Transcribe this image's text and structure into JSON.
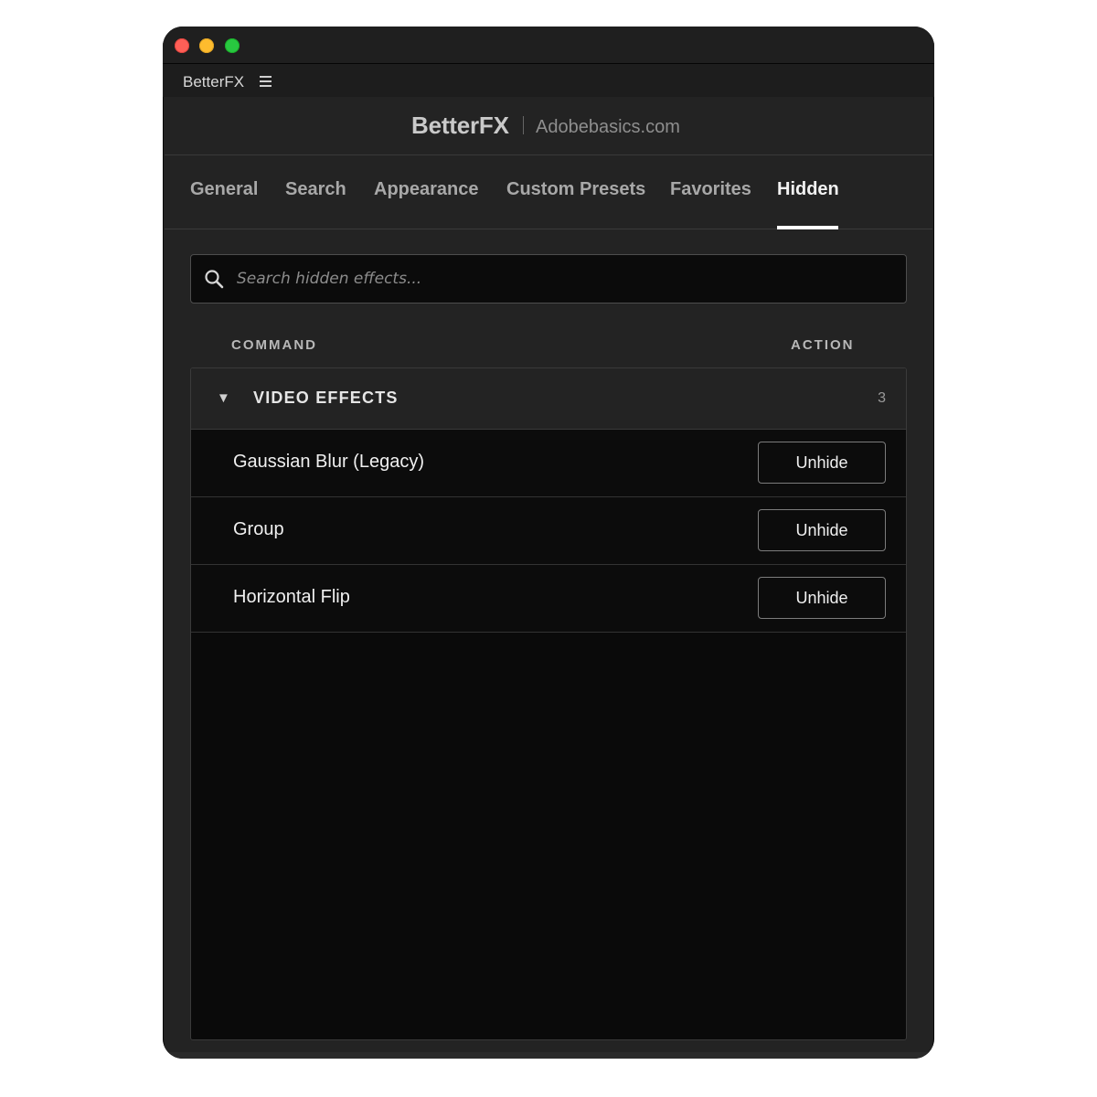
{
  "panel": {
    "name": "BetterFX"
  },
  "header": {
    "brand": "BetterFX",
    "site": "Adobebasics.com"
  },
  "tabs": [
    {
      "label": "General"
    },
    {
      "label": "Search"
    },
    {
      "label": "Appearance"
    },
    {
      "label": "Custom Presets"
    },
    {
      "label": "Favorites"
    },
    {
      "label": "Hidden",
      "active": true
    }
  ],
  "search": {
    "placeholder": "Search hidden effects..."
  },
  "columns": {
    "command": "COMMAND",
    "action": "ACTION"
  },
  "group": {
    "title": "VIDEO EFFECTS",
    "count": "3",
    "expanded": true
  },
  "rows": [
    {
      "label": "Gaussian Blur (Legacy)",
      "action": "Unhide"
    },
    {
      "label": "Group",
      "action": "Unhide"
    },
    {
      "label": "Horizontal Flip",
      "action": "Unhide"
    }
  ],
  "colors": {
    "window_bg": "#232323",
    "list_bg": "#0a0a0a",
    "active_tab": "#ffffff",
    "close": "#fe5f57",
    "minimize": "#febc2e",
    "zoom": "#28c840"
  },
  "icons": {
    "search": "search-icon",
    "menu": "hamburger-menu-icon",
    "caret": "triangle-down-icon"
  }
}
